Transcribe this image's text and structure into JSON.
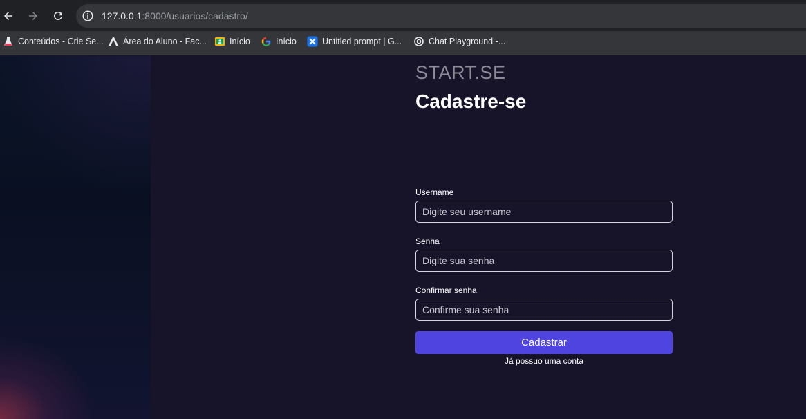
{
  "browser": {
    "url_host": "127.0.0.1",
    "url_rest": ":8000/usuarios/cadastro/"
  },
  "bookmarks": [
    {
      "label": "Conteúdos - Crie Se...",
      "icon": "flask-icon"
    },
    {
      "label": "Área do Aluno - Fac...",
      "icon": "a-logo-icon"
    },
    {
      "label": "Início",
      "icon": "classroom-icon"
    },
    {
      "label": "Início",
      "icon": "google-icon"
    },
    {
      "label": "Untitled prompt | G...",
      "icon": "ai-studio-icon"
    },
    {
      "label": "Chat Playground -...",
      "icon": "openai-icon"
    }
  ],
  "form": {
    "brand": "START.SE",
    "title": "Cadastre-se",
    "username_label": "Username",
    "username_placeholder": "Digite seu username",
    "password_label": "Senha",
    "password_placeholder": "Digite sua senha",
    "confirm_label": "Confirmar senha",
    "confirm_placeholder": "Confirme sua senha",
    "submit_label": "Cadastrar",
    "login_link": "Já possuo uma conta"
  },
  "colors": {
    "background": "#17142a",
    "accent": "#4f44e0"
  }
}
